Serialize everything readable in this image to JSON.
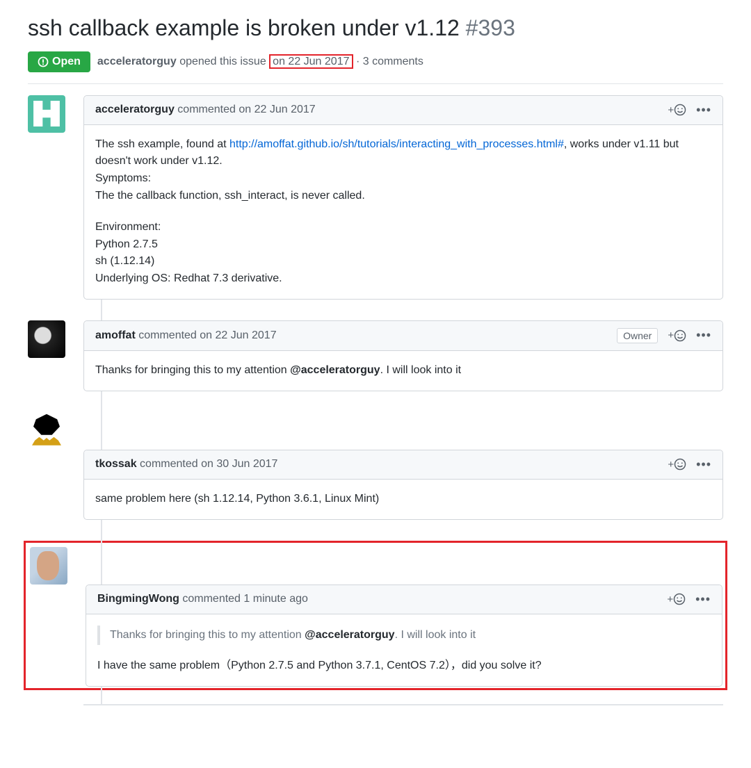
{
  "issue": {
    "title": "ssh callback example is broken under v1.12",
    "number": "#393",
    "state": "Open",
    "opened_by": "acceleratorguy",
    "opened_verb": "opened this issue",
    "opened_date": "on 22 Jun 2017",
    "comment_count_text": "3 comments",
    "separator_dot": "·"
  },
  "labels": {
    "owner": "Owner",
    "plus": "+",
    "kebab": "•••"
  },
  "comments": [
    {
      "author": "acceleratorguy",
      "verb": "commented",
      "date": "on 22 Jun 2017",
      "owner": false,
      "body_pretext": "The ssh example, found at ",
      "body_link": "http://amoffat.github.io/sh/tutorials/interacting_with_processes.html#",
      "body_posttext": ", works under v1.11 but doesn't work under v1.12.",
      "symptoms_label": "Symptoms:",
      "symptoms_text": "The the callback function, ssh_interact, is never called.",
      "env_label": "Environment:",
      "env_line1": "Python 2.7.5",
      "env_line2": "sh (1.12.14)",
      "env_line3": "Underlying OS: Redhat 7.3 derivative."
    },
    {
      "author": "amoffat",
      "verb": "commented",
      "date": "on 22 Jun 2017",
      "owner": true,
      "body_pre": "Thanks for bringing this to my attention ",
      "mention": "@acceleratorguy",
      "body_post": ". I will look into it"
    },
    {
      "author": "tkossak",
      "verb": "commented",
      "date": "on 30 Jun 2017",
      "owner": false,
      "body": "same problem here (sh 1.12.14, Python 3.6.1, Linux Mint)"
    },
    {
      "author": "BingmingWong",
      "verb": "commented",
      "date": "1 minute ago",
      "owner": false,
      "quote_pre": "Thanks for bringing this to my attention ",
      "quote_mention": "@acceleratorguy",
      "quote_post": ". I will look into it",
      "body": "I have the same problem（Python 2.7.5 and Python 3.7.1, CentOS 7.2），did you solve it?"
    }
  ]
}
